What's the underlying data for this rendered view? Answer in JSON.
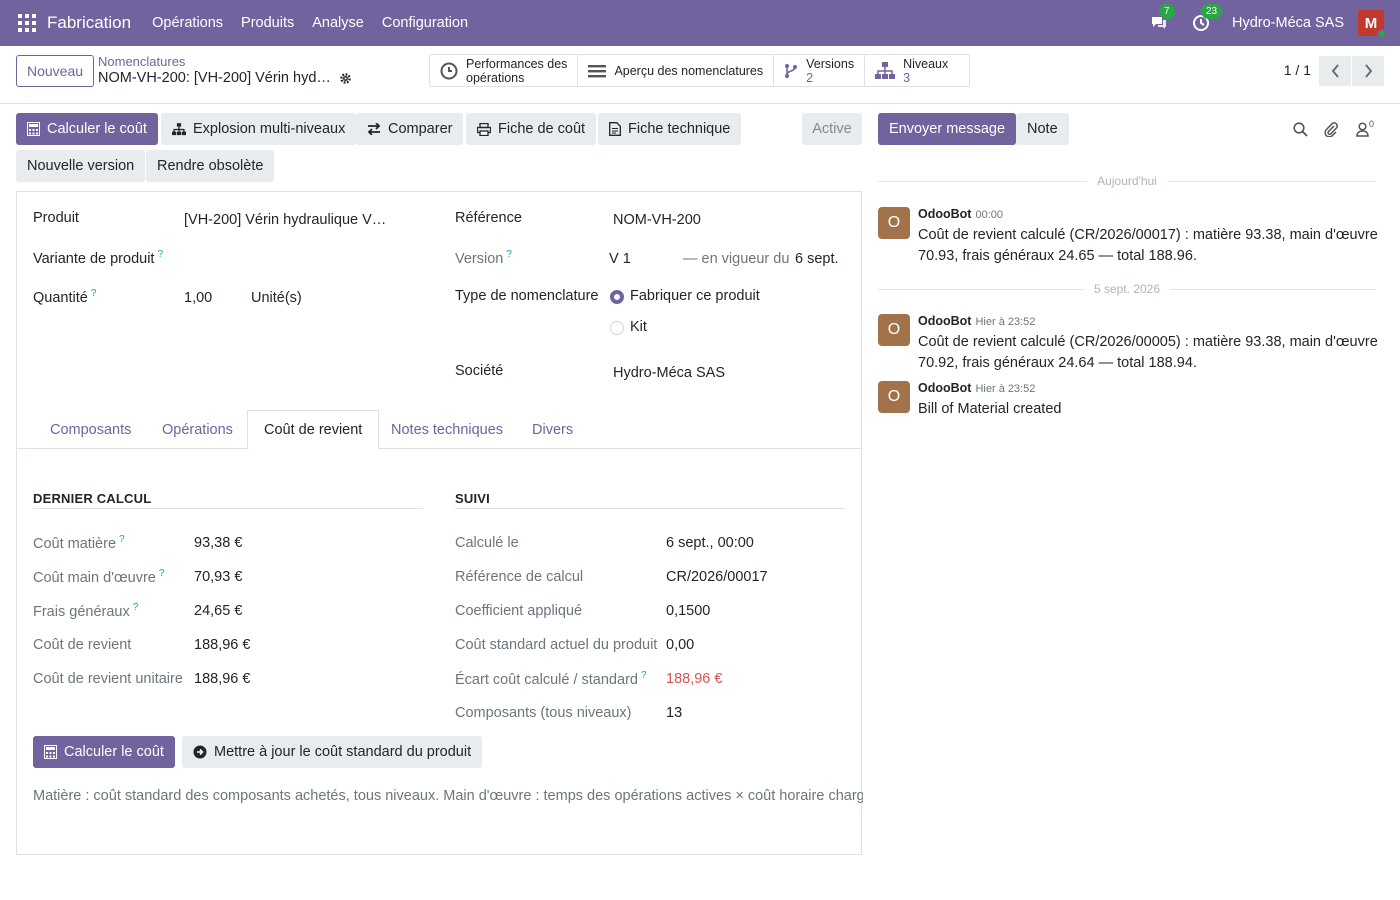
{
  "topnav": {
    "brand": "Fabrication",
    "menus": [
      "Opérations",
      "Produits",
      "Analyse",
      "Configuration"
    ],
    "chat_badge": "7",
    "activity_badge": "23",
    "company": "Hydro-Méca SAS",
    "avatar_letter": "M"
  },
  "control_panel": {
    "new_label": "Nouveau",
    "breadcrumb_parent": "Nomenclatures",
    "breadcrumb_current": "NOM-VH-200: [VH-200] Vérin hyd…",
    "smart_buttons": [
      {
        "line1": "Performances des",
        "line2": "opérations",
        "icon": "clock-icon"
      },
      {
        "line1": "Aperçu des nomenclatures",
        "icon": "list-icon"
      },
      {
        "line1": "Versions",
        "line2": "2",
        "icon": "branch-icon"
      },
      {
        "line1": "Niveaux",
        "line2": "3",
        "icon": "sitemap-icon"
      }
    ],
    "pager": "1 / 1"
  },
  "actions": {
    "compute_cost": "Calculer le coût",
    "multi_level": "Explosion multi-niveaux",
    "compare": "Comparer",
    "cost_sheet": "Fiche de coût",
    "tech_sheet": "Fiche technique",
    "new_version": "Nouvelle version",
    "obsolete": "Rendre obsolète",
    "status": "Active"
  },
  "form": {
    "product_label": "Produit",
    "product_value": "[VH-200] Vérin hydraulique V…",
    "variant_label": "Variante de produit",
    "quantity_label": "Quantité",
    "quantity_value": "1,00",
    "uom_value": "Unité(s)",
    "reference_label": "Référence",
    "reference_value": "NOM-VH-200",
    "version_label": "Version",
    "version_value": "V 1",
    "valid_label": "— en vigueur du",
    "valid_value": "6 sept.",
    "type_label": "Type de nomenclature",
    "type_option_1": "Fabriquer ce produit",
    "type_option_2": "Kit",
    "company_label": "Société",
    "company_value": "Hydro-Méca SAS",
    "help_mark": "?"
  },
  "tabs": [
    "Composants",
    "Opérations",
    "Coût de revient",
    "Notes techniques",
    "Divers"
  ],
  "cost": {
    "left_title": "DERNIER CALCUL",
    "right_title": "SUIVI",
    "left_rows": [
      {
        "label": "Coût matière",
        "value": "93,38 €",
        "help": true
      },
      {
        "label": "Coût main d'œuvre",
        "value": "70,93 €",
        "help": true
      },
      {
        "label": "Frais généraux",
        "value": "24,65 €",
        "help": true
      },
      {
        "label": "Coût de revient",
        "value": "188,96 €",
        "help": false
      },
      {
        "label": "Coût de revient unitaire",
        "value": "188,96 €",
        "help": false
      }
    ],
    "right_rows": [
      {
        "label": "Calculé le",
        "value": "6 sept., 00:00"
      },
      {
        "label": "Référence de calcul",
        "value": "CR/2026/00017"
      },
      {
        "label": "Coefficient appliqué",
        "value": "0,1500"
      },
      {
        "label": "Coût standard actuel du produit",
        "value": "0,00"
      },
      {
        "label": "Écart coût calculé / standard",
        "value": "188,96 €"
      },
      {
        "label": "Composants (tous niveaux)",
        "value": "13"
      }
    ],
    "btn_compute": "Calculer le coût",
    "btn_update": "Mettre à jour le coût standard du produit",
    "footnote": "Matière : coût standard des composants achetés, tous niveaux. Main d'œuvre : temps des opérations actives × coût horaire chargé du c"
  },
  "chatter": {
    "send_message": "Envoyer message",
    "note": "Note",
    "followers_count": "0",
    "sep_today": "Aujourd'hui",
    "sep_date": "5 sept. 2026",
    "messages": [
      {
        "author": "OdooBot",
        "time": "00:00",
        "initial": "O",
        "body": "Coût de revient calculé (CR/2026/00017) : matière 93.38, main d'œuvre 70.93, frais généraux 24.65 — total 188.96."
      },
      {
        "author": "OdooBot",
        "time": "Hier à 23:52",
        "initial": "O",
        "body": "Coût de revient calculé (CR/2026/00005) : matière 93.38, main d'œuvre 70.92, frais généraux 24.64 — total 188.94."
      },
      {
        "author": "OdooBot",
        "time": "Hier à 23:52",
        "initial": "O",
        "body": "Bill of Material created"
      }
    ]
  },
  "colors": {
    "brand": "#71639e",
    "danger": "#d9534f",
    "success": "#28a745"
  }
}
